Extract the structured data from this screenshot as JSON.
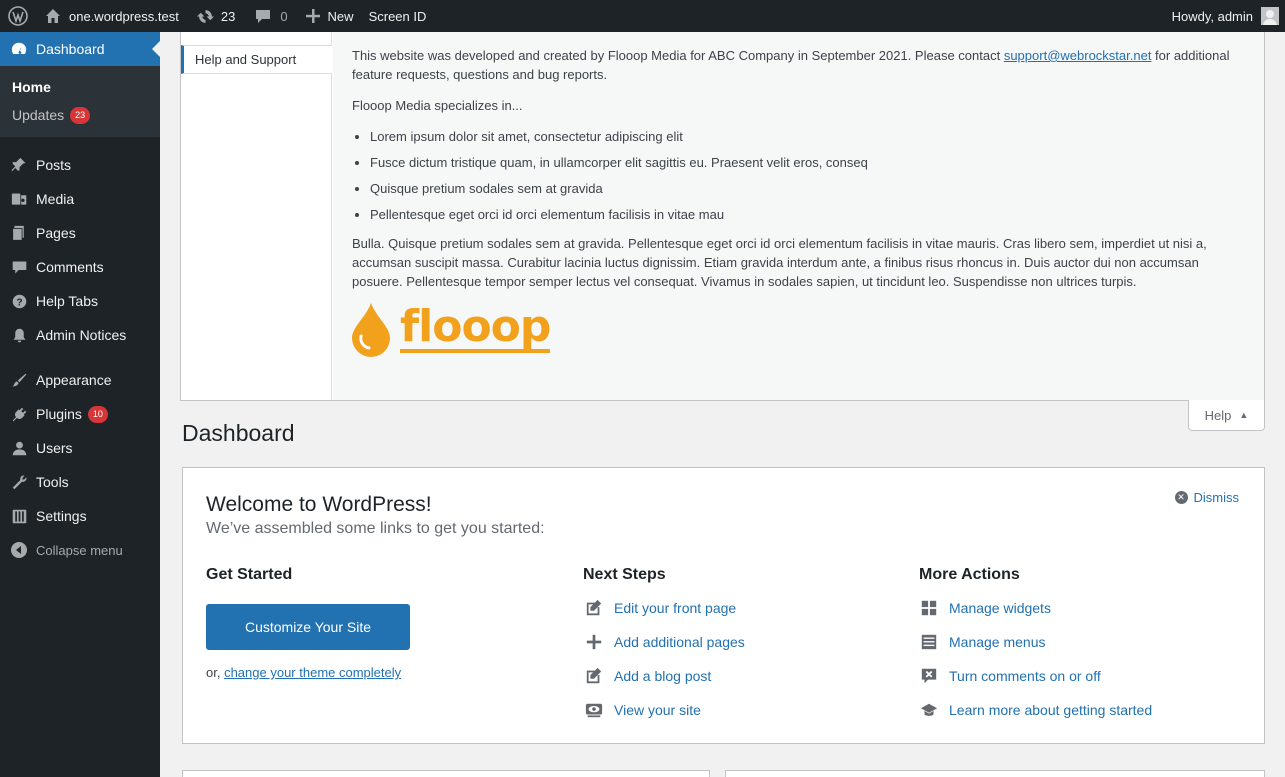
{
  "adminbar": {
    "site_name": "one.wordpress.test",
    "updates_count": "23",
    "comments_count": "0",
    "new_label": "New",
    "screen_id": "Screen ID",
    "howdy": "Howdy, admin"
  },
  "sidebar": {
    "dashboard": "Dashboard",
    "home": "Home",
    "updates": "Updates",
    "updates_badge": "23",
    "items": [
      {
        "label": "Posts",
        "icon": "pin-icon"
      },
      {
        "label": "Media",
        "icon": "media-icon"
      },
      {
        "label": "Pages",
        "icon": "pages-icon"
      },
      {
        "label": "Comments",
        "icon": "comments-icon"
      },
      {
        "label": "Help Tabs",
        "icon": "help-icon"
      },
      {
        "label": "Admin Notices",
        "icon": "bell-icon"
      }
    ],
    "items2": [
      {
        "label": "Appearance",
        "icon": "brush-icon"
      },
      {
        "label": "Plugins",
        "icon": "plugin-icon",
        "badge": "10"
      },
      {
        "label": "Users",
        "icon": "user-icon"
      },
      {
        "label": "Tools",
        "icon": "wrench-icon"
      },
      {
        "label": "Settings",
        "icon": "settings-icon"
      }
    ],
    "collapse": "Collapse menu"
  },
  "help": {
    "tab": "Help and Support",
    "intro_before": "This website was developed and created by Flooop Media for ABC Company in September 2021. Please contact ",
    "email": "support@webrockstar.net",
    "intro_after": " for additional feature requests, questions and bug reports.",
    "specializes": "Flooop Media specializes in...",
    "bullets": [
      "Lorem ipsum dolor sit amet, consectetur adipiscing elit",
      "Fusce dictum tristique quam, in ullamcorper elit sagittis eu. Praesent velit eros, conseq",
      "Quisque pretium sodales sem at gravida",
      "Pellentesque eget orci id orci elementum facilisis in vitae mau"
    ],
    "body": "Bulla. Quisque pretium sodales sem at gravida. Pellentesque eget orci id orci elementum facilisis in vitae mauris. Cras libero sem, imperdiet ut nisi a, accumsan suscipit massa. Curabitur lacinia luctus dignissim. Etiam gravida interdum ante, a finibus risus rhoncus in. Duis auctor dui non accumsan posuere. Pellentesque tempor semper lectus vel consequat. Vivamus in sodales sapien, ut tincidunt leo. Suspendisse non ultrices turpis.",
    "logo_text": "flooop",
    "help_button": "Help"
  },
  "page_title": "Dashboard",
  "welcome": {
    "title": "Welcome to WordPress!",
    "about": "We’ve assembled some links to get you started:",
    "dismiss": "Dismiss",
    "get_started": "Get Started",
    "customize": "Customize Your Site",
    "or": "or, ",
    "change_theme": "change your theme completely",
    "next_steps": "Next Steps",
    "more_actions": "More Actions",
    "next": [
      {
        "label": "Edit your front page",
        "icon": "edit-icon"
      },
      {
        "label": "Add additional pages",
        "icon": "plus-icon"
      },
      {
        "label": "Add a blog post",
        "icon": "edit-icon"
      },
      {
        "label": "View your site",
        "icon": "view-icon"
      }
    ],
    "more": [
      {
        "label": "Manage widgets",
        "icon": "widgets-icon"
      },
      {
        "label": "Manage menus",
        "icon": "menus-icon"
      },
      {
        "label": "Turn comments on or off",
        "icon": "comments-off-icon"
      },
      {
        "label": "Learn more about getting started",
        "icon": "learn-icon"
      }
    ]
  },
  "colors": {
    "accent": "#2271b1",
    "adminbar": "#1d2327",
    "badge": "#d63638",
    "logo": "#f2a11d"
  }
}
